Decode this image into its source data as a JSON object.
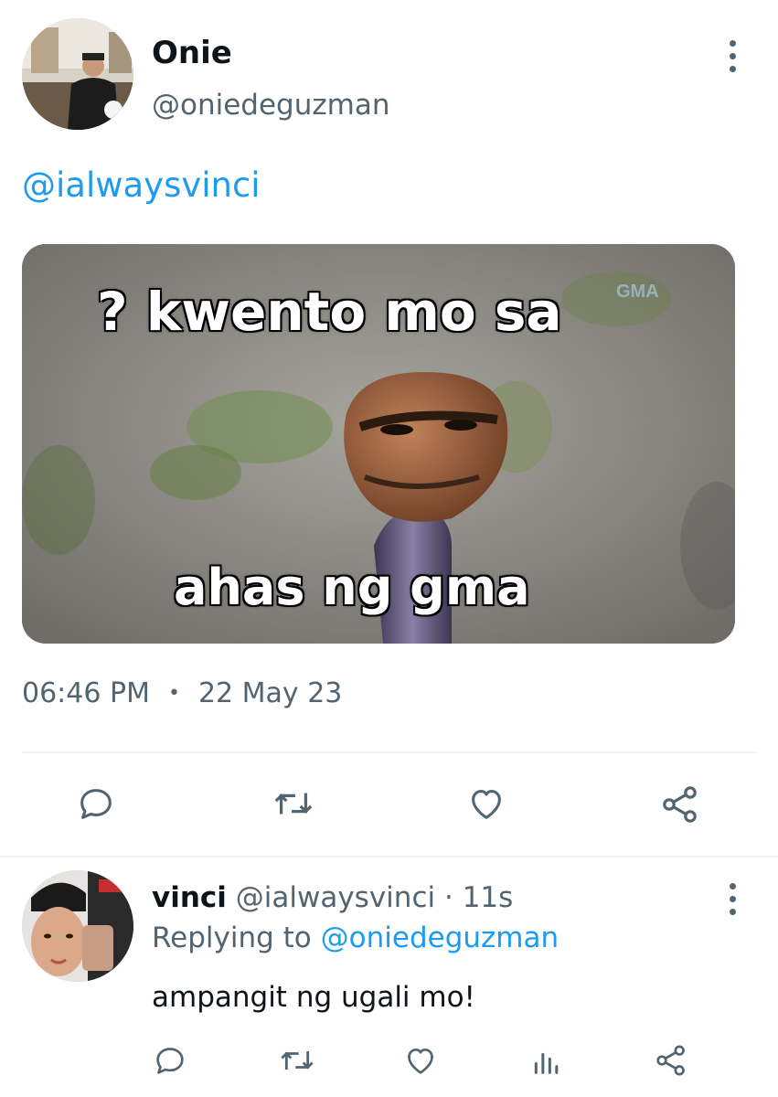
{
  "tweet": {
    "author_name": "Onie",
    "author_handle": "@oniedeguzman",
    "text_mention": "@ialwaysvinci",
    "meme": {
      "top_caption": "? kwento mo sa",
      "bottom_caption": "ahas ng gma",
      "watermark": "GMA"
    },
    "time": "06:46 PM",
    "separator": "•",
    "date": "22 May 23",
    "actions": [
      "reply-icon",
      "retweet-icon",
      "like-icon",
      "share-icon"
    ]
  },
  "reply": {
    "author_name": "vinci",
    "author_handle": "@ialwaysvinci",
    "dot": "·",
    "age": "11s",
    "replying_prefix": "Replying to",
    "replying_handle": "@oniedeguzman",
    "text": "ampangit ng ugali mo!",
    "actions": [
      "reply-icon",
      "retweet-icon",
      "like-icon",
      "views-icon",
      "share-icon"
    ]
  },
  "colors": {
    "accent": "#1d9bf0",
    "secondary_text": "#536471",
    "icon": "#536471"
  }
}
